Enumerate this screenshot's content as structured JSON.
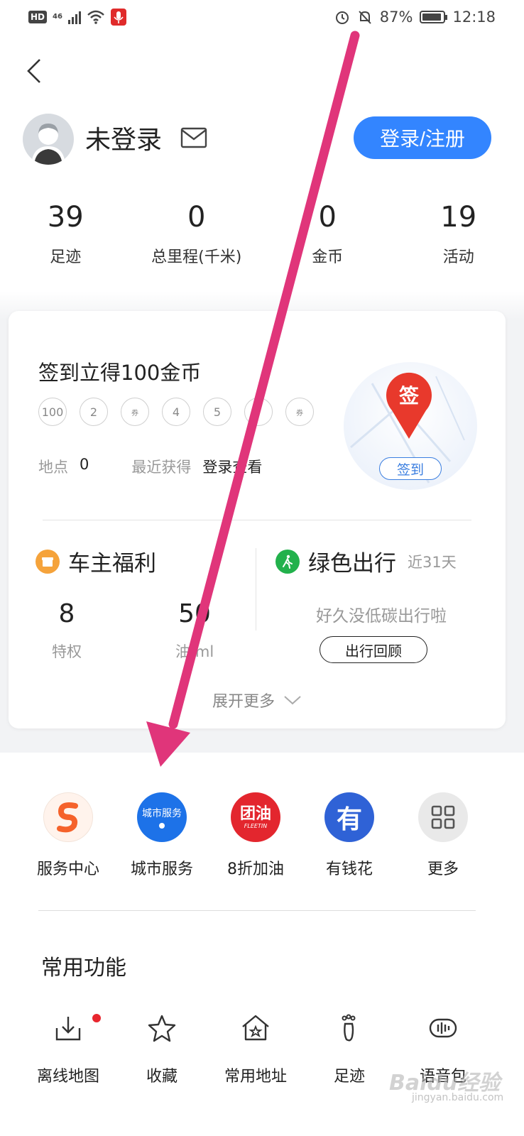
{
  "status_bar": {
    "left_badge": "HD",
    "network": "46",
    "battery_percent": "87%",
    "time": "12:18"
  },
  "profile": {
    "username": "未登录",
    "login_button": "登录/注册"
  },
  "stats": [
    {
      "value": "39",
      "label": "足迹"
    },
    {
      "value": "0",
      "label": "总里程(千米)"
    },
    {
      "value": "0",
      "label": "金币"
    },
    {
      "value": "19",
      "label": "活动"
    }
  ],
  "checkin": {
    "title": "签到立得100金币",
    "days": [
      "100",
      "2",
      "券",
      "4",
      "5",
      "",
      "券"
    ],
    "location_label": "地点",
    "location_value": "0",
    "recent_label": "最近获得",
    "recent_value": "登录查看",
    "badge_char": "签",
    "sign_button": "签到"
  },
  "perks": {
    "title": "车主福利",
    "items": [
      {
        "value": "8",
        "label": "特权"
      },
      {
        "value": "50",
        "label": "油/ml"
      }
    ]
  },
  "green_travel": {
    "title": "绿色出行",
    "subtitle": "近31天",
    "message": "好久没低碳出行啦",
    "button": "出行回顾"
  },
  "expand_more": "展开更多",
  "services": [
    {
      "label": "服务中心",
      "icon": "s-logo-icon",
      "color": "#fff3ec"
    },
    {
      "label": "城市服务",
      "icon": "city-service-icon",
      "icon_text": "城市服务",
      "color": "#1d72e8"
    },
    {
      "label": "8折加油",
      "icon": "tuanyou-icon",
      "icon_text": "团油",
      "icon_sub": "FLEETIN",
      "color": "#e3262e"
    },
    {
      "label": "有钱花",
      "icon": "youqianhua-icon",
      "icon_text": "有",
      "color": "#2f62d6"
    },
    {
      "label": "更多",
      "icon": "grid-icon",
      "color": "#e9e9e9"
    }
  ],
  "common_title": "常用功能",
  "tools": [
    {
      "label": "离线地图",
      "icon": "offline-map-icon"
    },
    {
      "label": "收藏",
      "icon": "star-icon"
    },
    {
      "label": "常用地址",
      "icon": "home-star-icon"
    },
    {
      "label": "足迹",
      "icon": "footprint-icon"
    },
    {
      "label": "语音包",
      "icon": "voice-pack-icon"
    }
  ],
  "watermark": {
    "text": "Baidu经验",
    "sub": "jingyan.baidu.com"
  },
  "colors": {
    "primary": "#3385ff",
    "annotation_arrow": "#e0357a"
  }
}
